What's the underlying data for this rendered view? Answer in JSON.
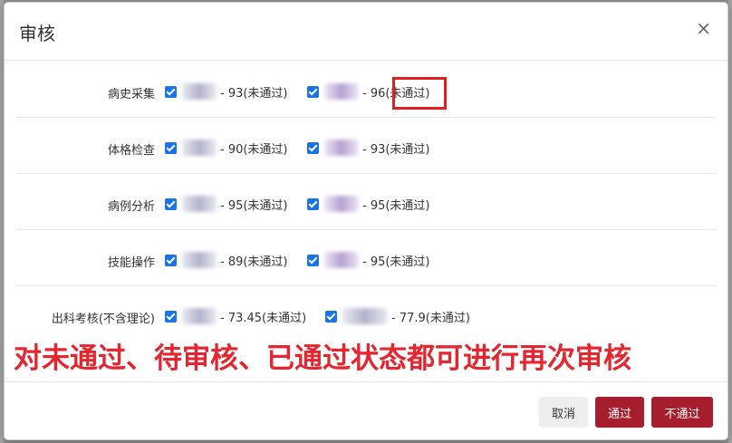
{
  "modal": {
    "title": "审核",
    "close_glyph": "×"
  },
  "rows": [
    {
      "label": "病史采集",
      "items": [
        {
          "score_text": "- 93(未通过)"
        },
        {
          "score_text": "- 96(未通过)"
        }
      ]
    },
    {
      "label": "体格检查",
      "items": [
        {
          "score_text": "- 90(未通过)"
        },
        {
          "score_text": "- 93(未通过)"
        }
      ]
    },
    {
      "label": "病例分析",
      "items": [
        {
          "score_text": "- 95(未通过)"
        },
        {
          "score_text": "- 95(未通过)"
        }
      ]
    },
    {
      "label": "技能操作",
      "items": [
        {
          "score_text": "- 89(未通过)"
        },
        {
          "score_text": "- 95(未通过)"
        }
      ]
    },
    {
      "label": "出科考核(不含理论)",
      "items": [
        {
          "score_text": "- 73.45(未通过)"
        },
        {
          "score_text": "- 77.9(未通过)"
        }
      ]
    }
  ],
  "annotation": {
    "text": "对未通过、待审核、已通过状态都可进行再次审核"
  },
  "footer": {
    "cancel_label": "取消",
    "pass_label": "通过",
    "fail_label": "不通过"
  },
  "colors": {
    "primary_button": "#a61d2e",
    "checkbox": "#1a73e8",
    "annotation": "#e3262f"
  }
}
